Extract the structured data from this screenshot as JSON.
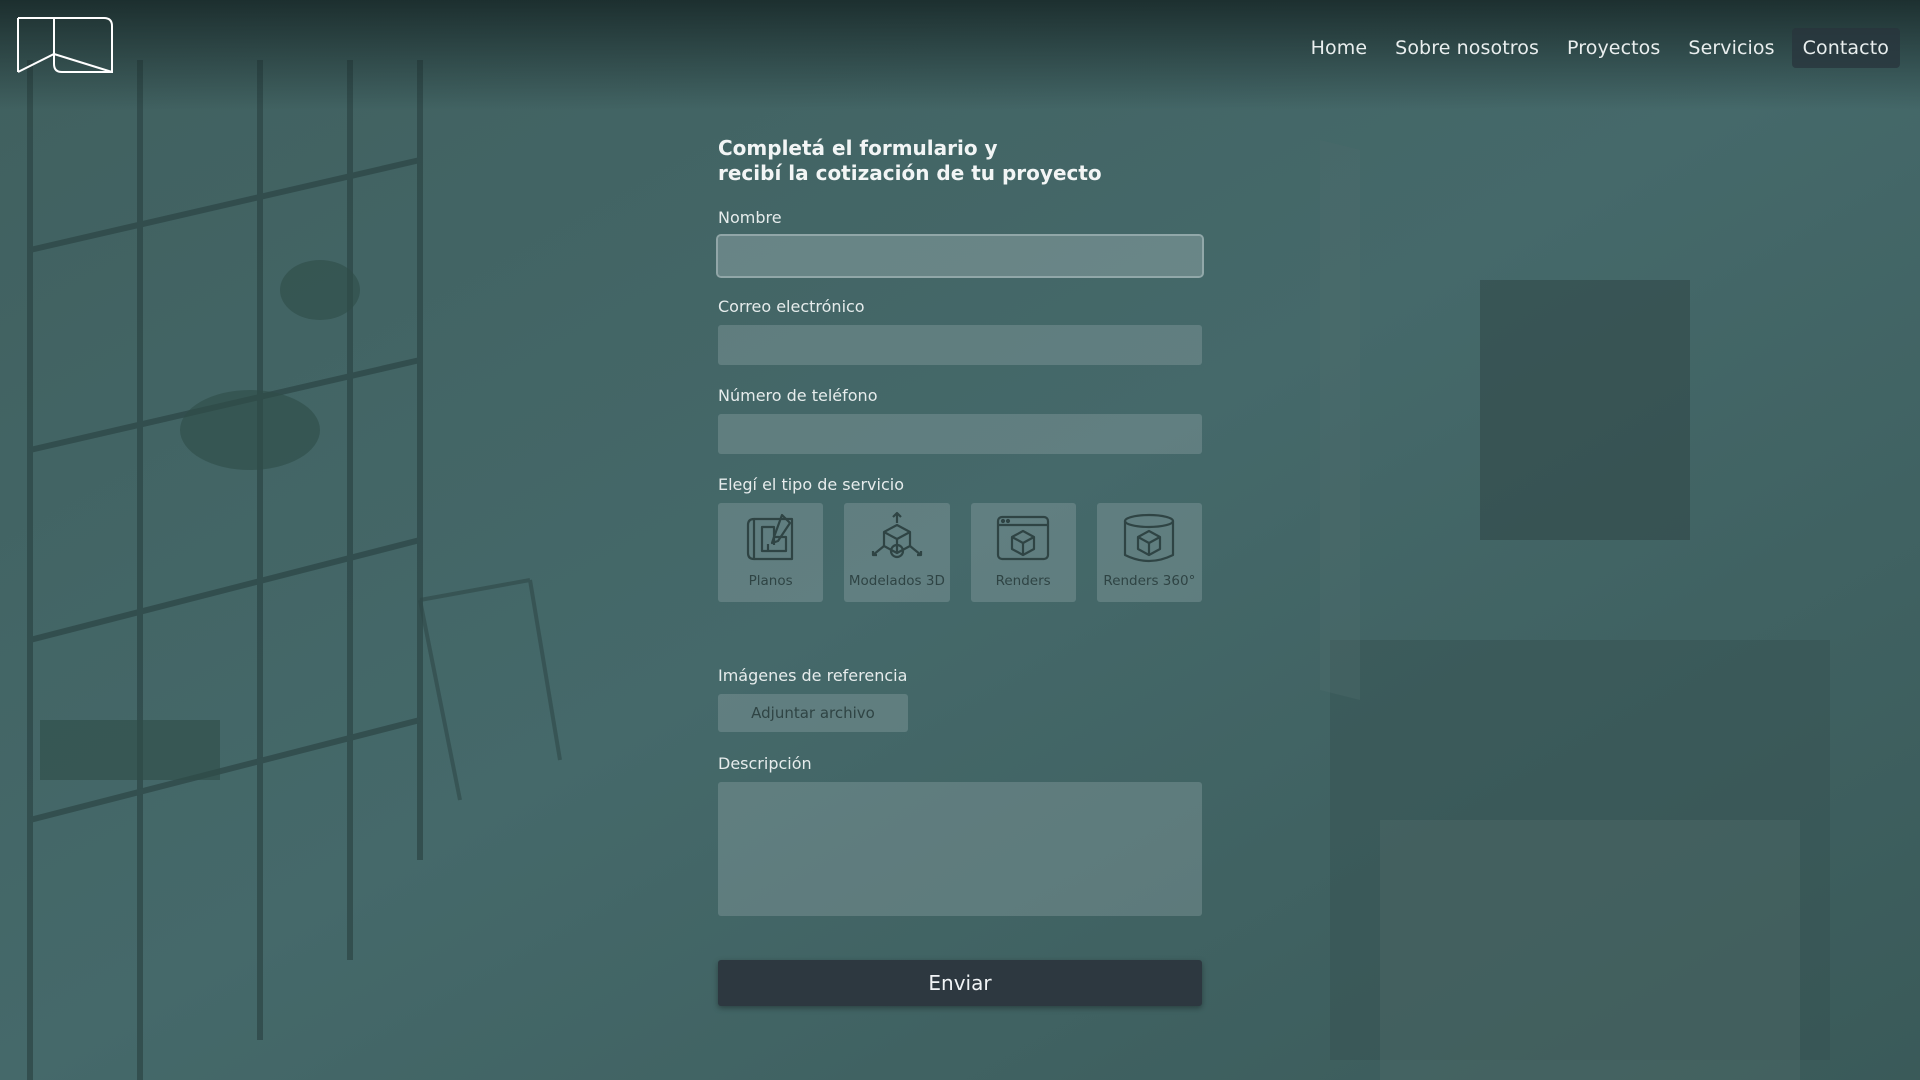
{
  "nav": {
    "items": [
      {
        "label": "Home"
      },
      {
        "label": "Sobre nosotros"
      },
      {
        "label": "Proyectos"
      },
      {
        "label": "Servicios"
      },
      {
        "label": "Contacto",
        "active": true
      }
    ]
  },
  "form": {
    "heading_line1": "Completá el formulario y",
    "heading_line2": "recibí la cotización de tu proyecto",
    "name_label": "Nombre",
    "email_label": "Correo electrónico",
    "phone_label": "Número de teléfono",
    "service_label": "Elegí el tipo de servicio",
    "services": [
      {
        "label": "Planos",
        "icon": "blueprint-icon"
      },
      {
        "label": "Modelados 3D",
        "icon": "3d-model-icon"
      },
      {
        "label": "Renders",
        "icon": "render-icon"
      },
      {
        "label": "Renders 360°",
        "icon": "render-360-icon"
      }
    ],
    "images_label": "Imágenes de referencia",
    "attach_label": "Adjuntar archivo",
    "description_label": "Descripción",
    "submit_label": "Enviar"
  },
  "colors": {
    "overlay": "#3e5f5e",
    "submit_bg": "#2d3840",
    "nav_active_bg": "#28343c"
  }
}
